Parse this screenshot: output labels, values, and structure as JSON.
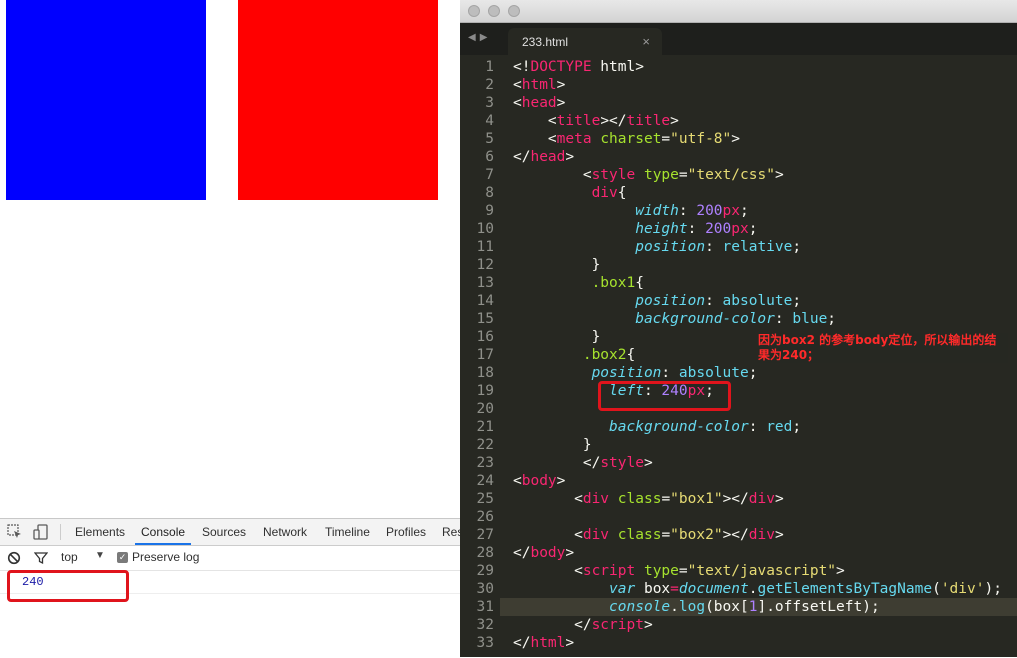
{
  "devtools": {
    "tabs": [
      "Elements",
      "Console",
      "Sources",
      "Network",
      "Timeline",
      "Profiles",
      "Res"
    ],
    "active_tab": "Console",
    "filter_context": "top",
    "preserve_log_label": "Preserve log",
    "preserve_log_checked": true,
    "console_output": "240"
  },
  "editor": {
    "tab_title": "233.html",
    "tab_close": "×",
    "active_line": 31,
    "annotation": "因为box2 的参考body定位，所以输出的结果为240；",
    "line_numbers": [
      "1",
      "2",
      "3",
      "4",
      "5",
      "6",
      "7",
      "8",
      "9",
      "10",
      "11",
      "12",
      "13",
      "14",
      "15",
      "16",
      "17",
      "18",
      "19",
      "20",
      "21",
      "22",
      "23",
      "24",
      "25",
      "26",
      "27",
      "28",
      "29",
      "30",
      "31",
      "32",
      "33"
    ]
  },
  "colors": {
    "box1": "#0000ff",
    "box2": "#ff0000",
    "highlight_border": "#e0141c",
    "editor_bg": "#272822"
  },
  "code": {
    "l1": [
      "<!",
      "DOCTYPE",
      " html>"
    ],
    "l2": [
      "<",
      "html",
      ">"
    ],
    "l3": [
      "<",
      "head",
      ">"
    ],
    "l4": [
      "    <",
      "title",
      "></",
      "title",
      ">"
    ],
    "l5": [
      "    <",
      "meta",
      " ",
      "charset",
      "=",
      "\"utf-8\"",
      ">"
    ],
    "l6": [
      "</",
      "head",
      ">"
    ],
    "l7": [
      "        <",
      "style",
      " ",
      "type",
      "=",
      "\"text/css\"",
      ">"
    ],
    "l8": [
      "         ",
      "div",
      "{"
    ],
    "l9": [
      "              ",
      "width",
      ": ",
      "200",
      "px",
      ";"
    ],
    "l10": [
      "              ",
      "height",
      ": ",
      "200",
      "px",
      ";"
    ],
    "l11": [
      "              ",
      "position",
      ": ",
      "relative",
      ";"
    ],
    "l12": [
      "         }"
    ],
    "l13": [
      "         ",
      ".box1",
      "{"
    ],
    "l14": [
      "              ",
      "position",
      ": ",
      "absolute",
      ";"
    ],
    "l15": [
      "              ",
      "background-color",
      ": ",
      "blue",
      ";"
    ],
    "l16": [
      "         }"
    ],
    "l17": [
      "        ",
      ".box2",
      "{"
    ],
    "l18": [
      "         ",
      "position",
      ": ",
      "absolute",
      ";"
    ],
    "l19": [
      "           ",
      "left",
      ": ",
      "240",
      "px",
      ";"
    ],
    "l20": [
      ""
    ],
    "l21": [
      "           ",
      "background-color",
      ": ",
      "red",
      ";"
    ],
    "l22": [
      "        }"
    ],
    "l23": [
      "        </",
      "style",
      ">"
    ],
    "l24": [
      "<",
      "body",
      ">"
    ],
    "l25": [
      "       <",
      "div",
      " ",
      "class",
      "=",
      "\"box1\"",
      "></",
      "div",
      ">"
    ],
    "l26": [
      ""
    ],
    "l27": [
      "       <",
      "div",
      " ",
      "class",
      "=",
      "\"box2\"",
      "></",
      "div",
      ">"
    ],
    "l28": [
      "</",
      "body",
      ">"
    ],
    "l29": [
      "       <",
      "script",
      " ",
      "type",
      "=",
      "\"text/javascript\"",
      ">"
    ],
    "l30": [
      "           ",
      "var",
      " box",
      "=",
      "document",
      ".",
      "getElementsByTagName",
      "(",
      "'div'",
      ");"
    ],
    "l31": [
      "           ",
      "console",
      ".",
      "log",
      "(box[",
      "1",
      "].offsetLeft",
      ");"
    ],
    "l32": [
      "       </",
      "script",
      ">"
    ],
    "l33": [
      "</",
      "html",
      ">"
    ]
  }
}
